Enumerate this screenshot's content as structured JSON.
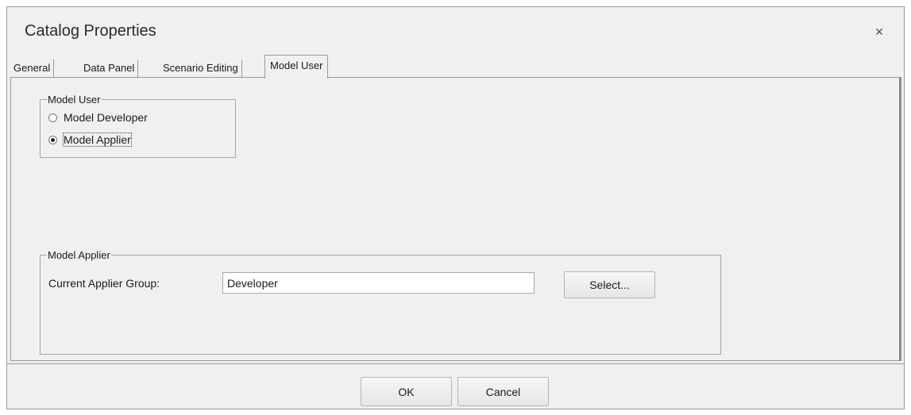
{
  "window": {
    "title": "Catalog Properties",
    "close_glyph": "✕"
  },
  "tabs": [
    {
      "label": "General"
    },
    {
      "label": "Data Panel"
    },
    {
      "label": "Scenario Editing"
    },
    {
      "label": "Model User",
      "active": true
    }
  ],
  "model_user_group": {
    "legend": "Model User",
    "options": [
      {
        "label": "Model Developer",
        "checked": false
      },
      {
        "label": "Model Applier",
        "checked": true
      }
    ]
  },
  "model_applier_group": {
    "legend": "Model Applier",
    "current_group_label": "Current Applier Group:",
    "current_group_value": "Developer",
    "select_button": "Select..."
  },
  "footer": {
    "ok": "OK",
    "cancel": "Cancel"
  }
}
